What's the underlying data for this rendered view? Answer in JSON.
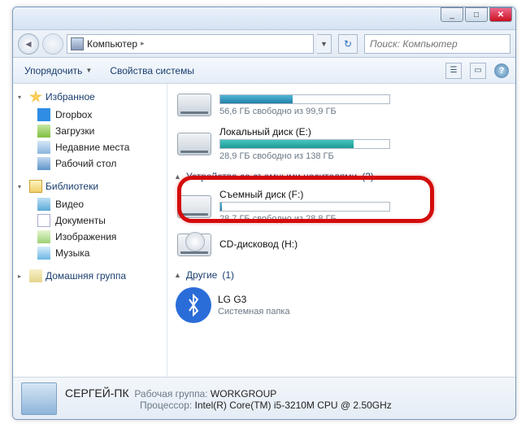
{
  "titlebar": {
    "min": "_",
    "max": "□",
    "close": "✕"
  },
  "nav": {
    "back": "◄",
    "fwd": " ",
    "breadcrumb": "Компьютер",
    "sep": "▸",
    "search_placeholder": "Поиск: Компьютер"
  },
  "toolbar": {
    "organize": "Упорядочить",
    "sysprops": "Свойства системы"
  },
  "sidebar": {
    "favorites": {
      "label": "Избранное",
      "items": [
        {
          "label": "Dropbox",
          "icon": "ic-dropbox"
        },
        {
          "label": "Загрузки",
          "icon": "ic-dl"
        },
        {
          "label": "Недавние места",
          "icon": "ic-recent"
        },
        {
          "label": "Рабочий стол",
          "icon": "ic-desk"
        }
      ]
    },
    "libraries": {
      "label": "Библиотеки",
      "items": [
        {
          "label": "Видео",
          "icon": "ic-video"
        },
        {
          "label": "Документы",
          "icon": "ic-doc"
        },
        {
          "label": "Изображения",
          "icon": "ic-img"
        },
        {
          "label": "Музыка",
          "icon": "ic-music"
        }
      ]
    },
    "homegroup": {
      "label": "Домашняя группа"
    }
  },
  "main": {
    "hdd1": {
      "free_text": "56,6 ГБ свободно из 99,9 ГБ",
      "fill": 43
    },
    "hdd2": {
      "name": "Локальный диск (E:)",
      "free_text": "28,9 ГБ свободно из 138 ГБ",
      "fill": 79
    },
    "group_removable": {
      "label": "Устройства со съемными носителями",
      "count": "(2)"
    },
    "removable": {
      "name": "Съемный диск (F:)",
      "free_text": "28,7 ГБ свободно из 28,8 ГБ",
      "fill": 1
    },
    "cd": {
      "name": "CD-дисковод (H:)"
    },
    "group_other": {
      "label": "Другие",
      "count": "(1)"
    },
    "bt": {
      "name": "LG G3",
      "sub": "Системная папка"
    }
  },
  "status": {
    "title": "СЕРГЕЙ-ПК",
    "workgroup_label": "Рабочая группа:",
    "workgroup_value": "WORKGROUP",
    "cpu_label": "Процессор:",
    "cpu_value": "Intel(R) Core(TM) i5-3210M CPU @ 2.50GHz"
  }
}
